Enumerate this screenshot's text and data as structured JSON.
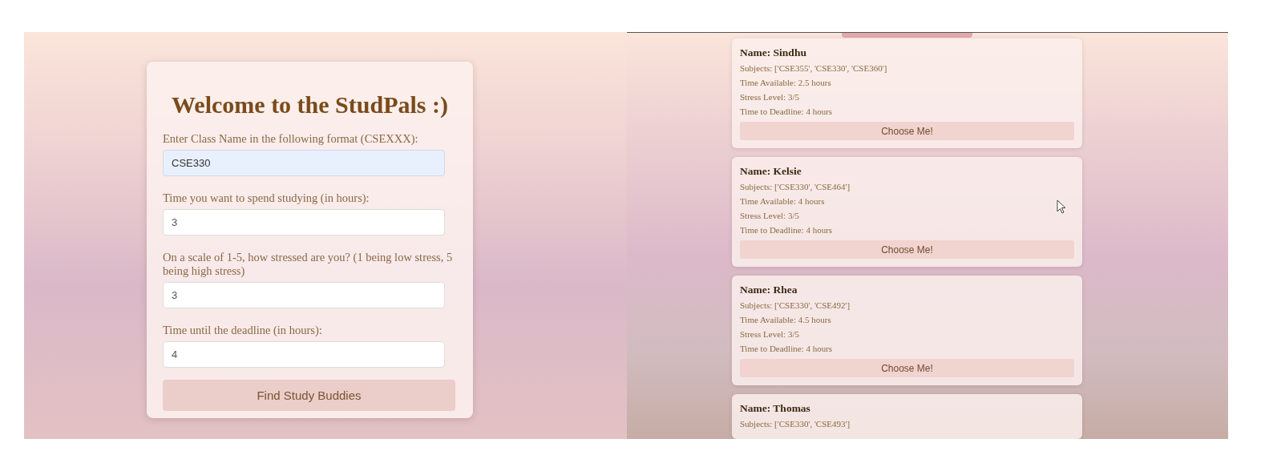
{
  "form": {
    "title": "Welcome to the StudPals :)",
    "fields": [
      {
        "label": "Enter Class Name in the following format (CSEXXX):",
        "value": "CSE330",
        "autofilled": true
      },
      {
        "label": "Time you want to spend studying (in hours):",
        "value": "3",
        "autofilled": false
      },
      {
        "label": "On a scale of 1-5, how stressed are you? (1 being low stress, 5 being high stress)",
        "value": "3",
        "autofilled": false
      },
      {
        "label": "Time until the deadline (in hours):",
        "value": "4",
        "autofilled": false
      }
    ],
    "submit_button": "Find Study Buddies"
  },
  "results": {
    "buddies": [
      {
        "name": "Name: Sindhu",
        "details": [
          "Subjects: ['CSE355', 'CSE330', 'CSE360']",
          "Time Available: 2.5 hours",
          "Stress Level: 3/5",
          "Time to Deadline: 4 hours"
        ],
        "button": "Choose Me!"
      },
      {
        "name": "Name: Kelsie",
        "details": [
          "Subjects: ['CSE330', 'CSE464']",
          "Time Available: 4 hours",
          "Stress Level: 3/5",
          "Time to Deadline: 4 hours"
        ],
        "button": "Choose Me!"
      },
      {
        "name": "Name: Rhea",
        "details": [
          "Subjects: ['CSE330', 'CSE492']",
          "Time Available: 4.5 hours",
          "Stress Level: 3/5",
          "Time to Deadline: 4 hours"
        ],
        "button": "Choose Me!"
      },
      {
        "name": "Name: Thomas",
        "details": [
          "Subjects: ['CSE330', 'CSE493']"
        ]
      }
    ]
  }
}
